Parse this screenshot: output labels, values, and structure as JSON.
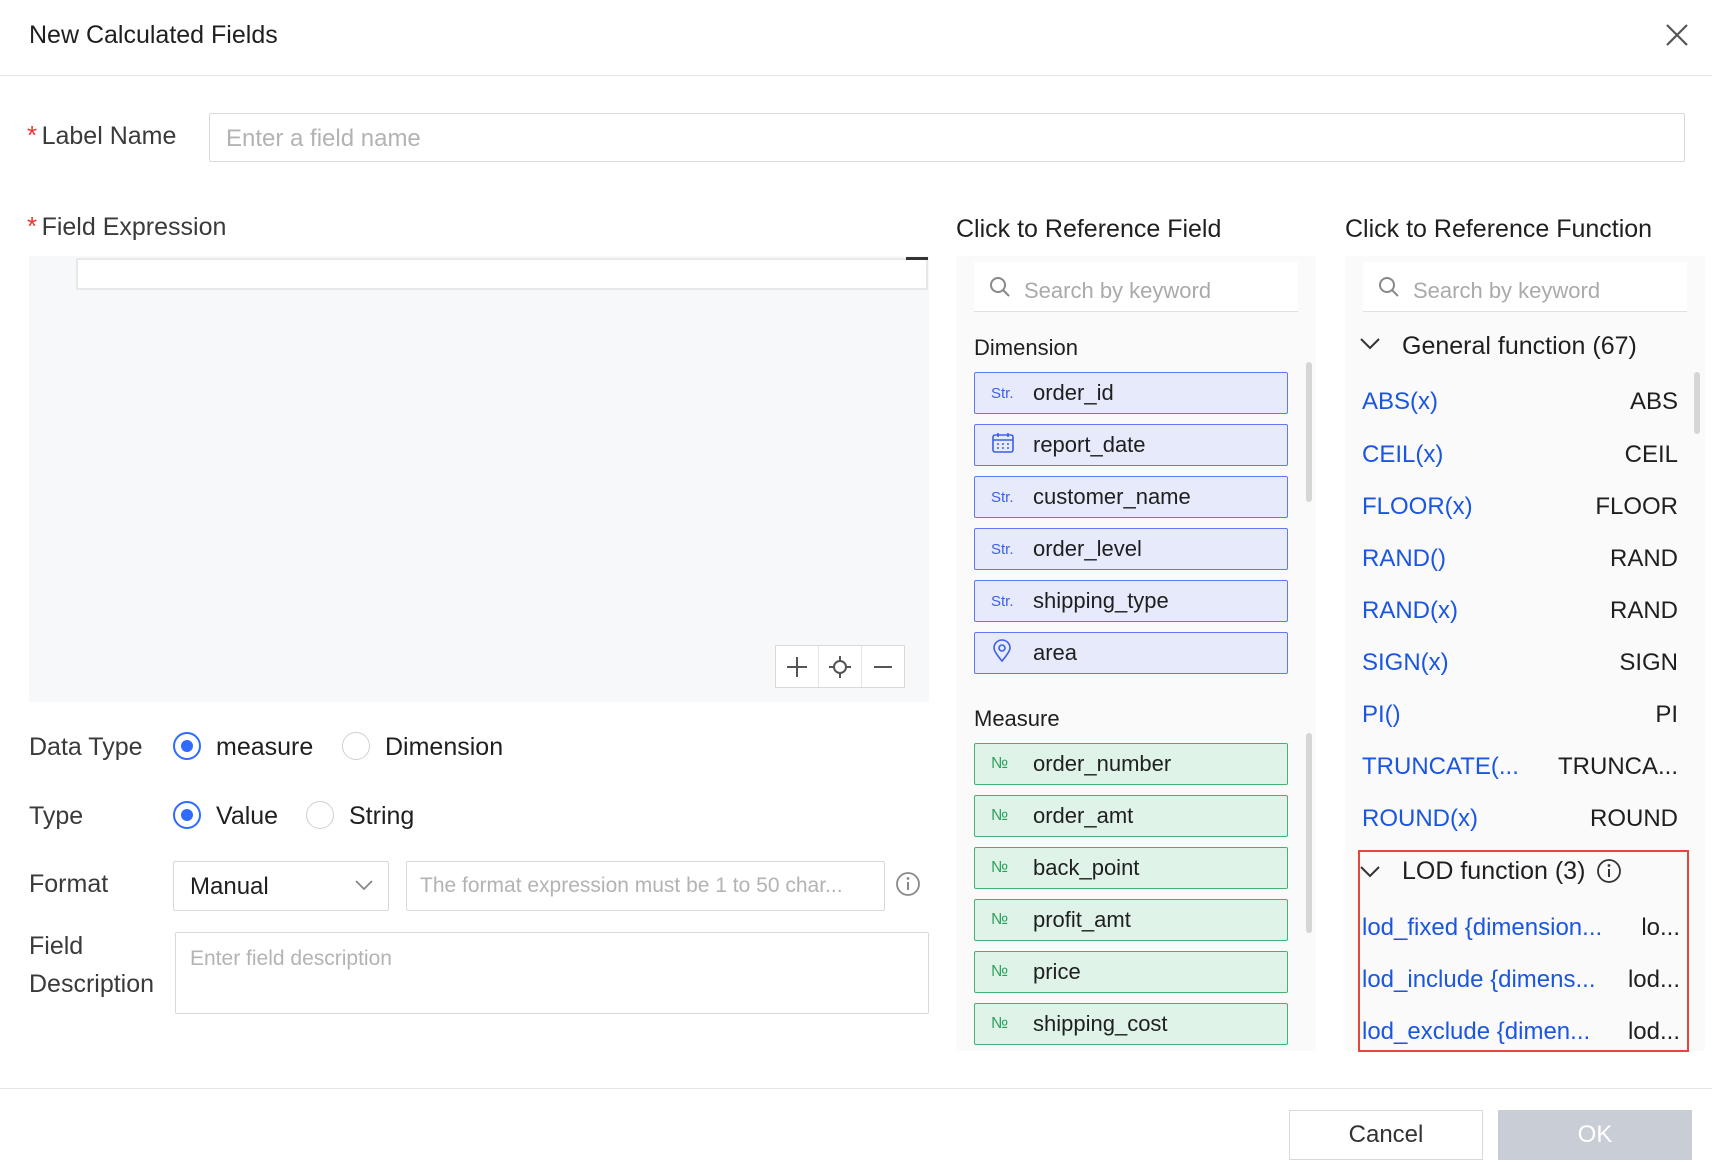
{
  "dialog": {
    "title": "New Calculated Fields"
  },
  "label_name": {
    "label": "Label Name",
    "placeholder": "Enter a field name"
  },
  "field_expression": {
    "label": "Field Expression"
  },
  "data_type": {
    "label": "Data Type",
    "options": [
      "measure",
      "Dimension"
    ],
    "selected": "measure"
  },
  "type": {
    "label": "Type",
    "options": [
      "Value",
      "String"
    ],
    "selected": "Value"
  },
  "format": {
    "label": "Format",
    "selected": "Manual",
    "placeholder": "The format expression must be 1 to 50 char..."
  },
  "description": {
    "label_line1": "Field",
    "label_line2": "Description",
    "placeholder": "Enter field description"
  },
  "reference_field": {
    "title": "Click to Reference Field",
    "search_placeholder": "Search by keyword",
    "dimension_label": "Dimension",
    "dimensions": [
      {
        "icon": "Str.",
        "name": "order_id"
      },
      {
        "icon": "calendar-icon",
        "name": "report_date"
      },
      {
        "icon": "Str.",
        "name": "customer_name"
      },
      {
        "icon": "Str.",
        "name": "order_level"
      },
      {
        "icon": "Str.",
        "name": "shipping_type"
      },
      {
        "icon": "location-icon",
        "name": "area"
      }
    ],
    "measure_label": "Measure",
    "measures": [
      {
        "icon": "№",
        "name": "order_number"
      },
      {
        "icon": "№",
        "name": "order_amt"
      },
      {
        "icon": "№",
        "name": "back_point"
      },
      {
        "icon": "№",
        "name": "profit_amt"
      },
      {
        "icon": "№",
        "name": "price"
      },
      {
        "icon": "№",
        "name": "shipping_cost"
      }
    ]
  },
  "reference_function": {
    "title": "Click to Reference Function",
    "search_placeholder": "Search by keyword",
    "general_label": "General function (67)",
    "general": [
      {
        "f": "ABS(x)",
        "n": "ABS"
      },
      {
        "f": "CEIL(x)",
        "n": "CEIL"
      },
      {
        "f": "FLOOR(x)",
        "n": "FLOOR"
      },
      {
        "f": "RAND()",
        "n": "RAND"
      },
      {
        "f": "RAND(x)",
        "n": "RAND"
      },
      {
        "f": "SIGN(x)",
        "n": "SIGN"
      },
      {
        "f": "PI()",
        "n": "PI"
      },
      {
        "f": "TRUNCATE(...",
        "n": "TRUNCA..."
      },
      {
        "f": "ROUND(x)",
        "n": "ROUND"
      }
    ],
    "lod_label": "LOD function (3)",
    "lod": [
      {
        "f": "lod_fixed {dimension...",
        "n": "lo..."
      },
      {
        "f": "lod_include {dimens...",
        "n": "lod..."
      },
      {
        "f": "lod_exclude {dimen...",
        "n": "lod..."
      }
    ]
  },
  "footer": {
    "cancel": "Cancel",
    "ok": "OK"
  },
  "colors": {
    "accent": "#2f6bff",
    "link": "#1b56e0",
    "required": "#e8352e",
    "highlight": "#e5473c"
  }
}
